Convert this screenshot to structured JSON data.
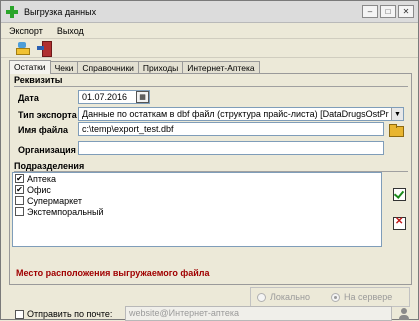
{
  "window": {
    "title": "Выгрузка данных"
  },
  "menu": {
    "items": [
      "Экспорт",
      "Выход"
    ]
  },
  "tabs": [
    "Остатки",
    "Чеки",
    "Справочники",
    "Приходы",
    "Интернет-Аптека"
  ],
  "requisites": {
    "title": "Реквизиты",
    "date_label": "Дата",
    "date_value": "01.07.2016",
    "export_type_label": "Тип экспорта",
    "export_type_value": "Данные по остаткам в dbf файл (структура прайс-листа) [DataDrugsOstPr",
    "filename_label": "Имя файла",
    "filename_value": "c:\\temp\\export_test.dbf",
    "organization_label": "Организация",
    "organization_value": ""
  },
  "departments": {
    "title": "Подразделения",
    "items": [
      {
        "label": "Аптека",
        "checked": true
      },
      {
        "label": "Офис",
        "checked": true
      },
      {
        "label": "Супермаркет",
        "checked": false
      },
      {
        "label": "Экстемпоральный",
        "checked": false
      }
    ]
  },
  "location": {
    "label": "Место расположения выгружаемого файла",
    "options": [
      "Локально",
      "На сервере"
    ],
    "selected": "На сервере"
  },
  "email": {
    "checkbox_label": "Отправить по почте:",
    "checked": false,
    "value": "website@Интернет-аптека"
  },
  "colors": {
    "accent_red": "#a00000",
    "icon_green": "#2aa52a"
  }
}
